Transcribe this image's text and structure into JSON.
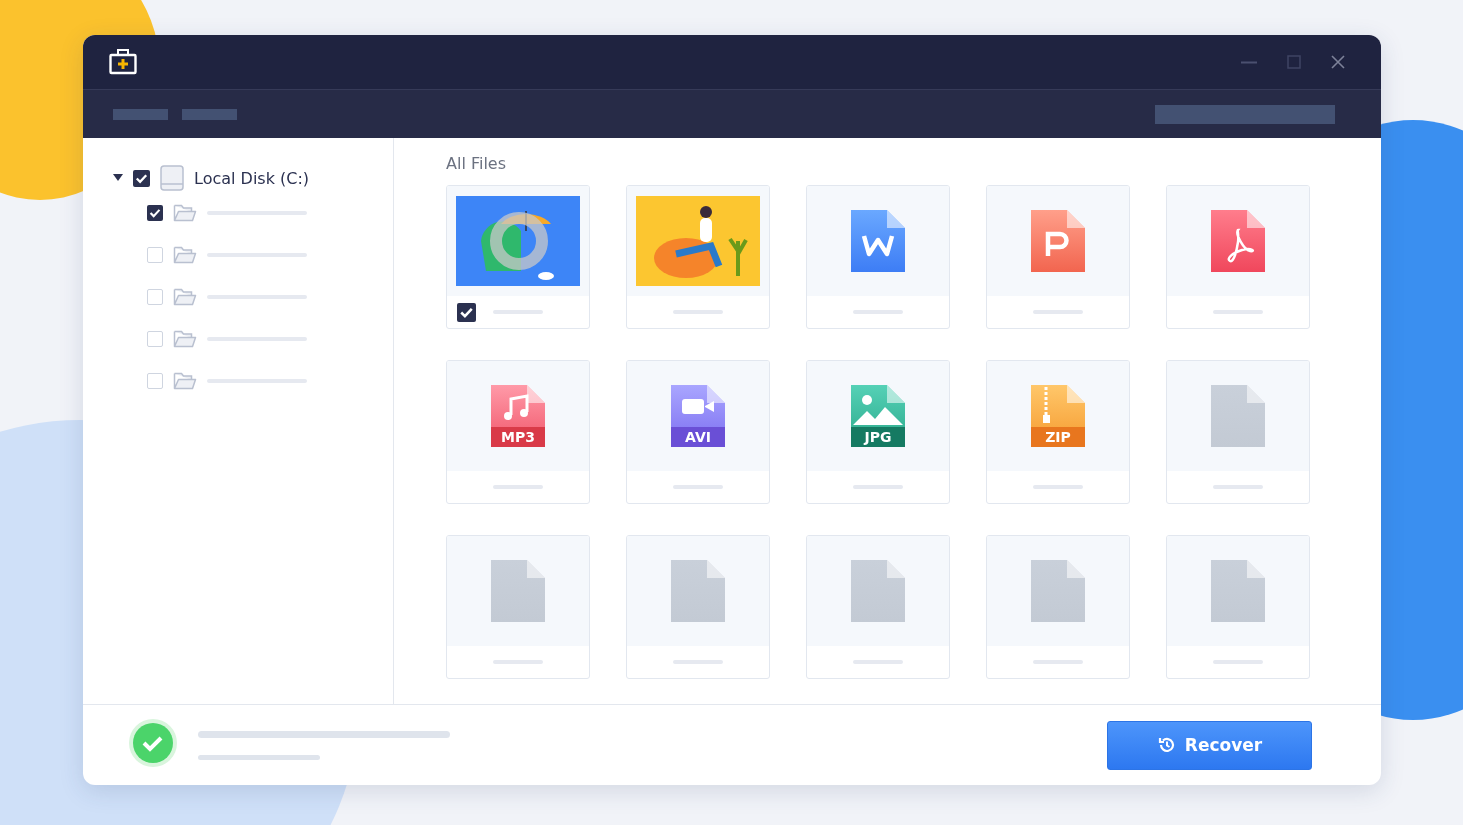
{
  "tree": {
    "label": "Local Disk (C:)",
    "expanded": true,
    "checked": true,
    "children": [
      {
        "checked": true
      },
      {
        "checked": false
      },
      {
        "checked": false
      },
      {
        "checked": false
      },
      {
        "checked": false
      }
    ]
  },
  "section_title": "All Files",
  "files": [
    {
      "kind": "photo",
      "checked": true,
      "loading": true
    },
    {
      "kind": "illustration",
      "checked": false,
      "loading": false
    },
    {
      "kind": "word",
      "checked": false,
      "loading": false
    },
    {
      "kind": "slides",
      "checked": false,
      "loading": false
    },
    {
      "kind": "pdf",
      "checked": false,
      "loading": false
    },
    {
      "kind": "audio",
      "badge": "MP3",
      "checked": false,
      "loading": false
    },
    {
      "kind": "video",
      "badge": "AVI",
      "checked": false,
      "loading": false
    },
    {
      "kind": "image",
      "badge": "JPG",
      "checked": false,
      "loading": false
    },
    {
      "kind": "archive",
      "badge": "ZIP",
      "checked": false,
      "loading": false
    },
    {
      "kind": "blank",
      "checked": false,
      "loading": false
    },
    {
      "kind": "blank",
      "checked": false,
      "loading": false
    },
    {
      "kind": "blank",
      "checked": false,
      "loading": false
    },
    {
      "kind": "blank",
      "checked": false,
      "loading": false
    },
    {
      "kind": "blank",
      "checked": false,
      "loading": false
    },
    {
      "kind": "blank",
      "checked": false,
      "loading": false
    }
  ],
  "footer": {
    "success": true,
    "button": "Recover"
  }
}
